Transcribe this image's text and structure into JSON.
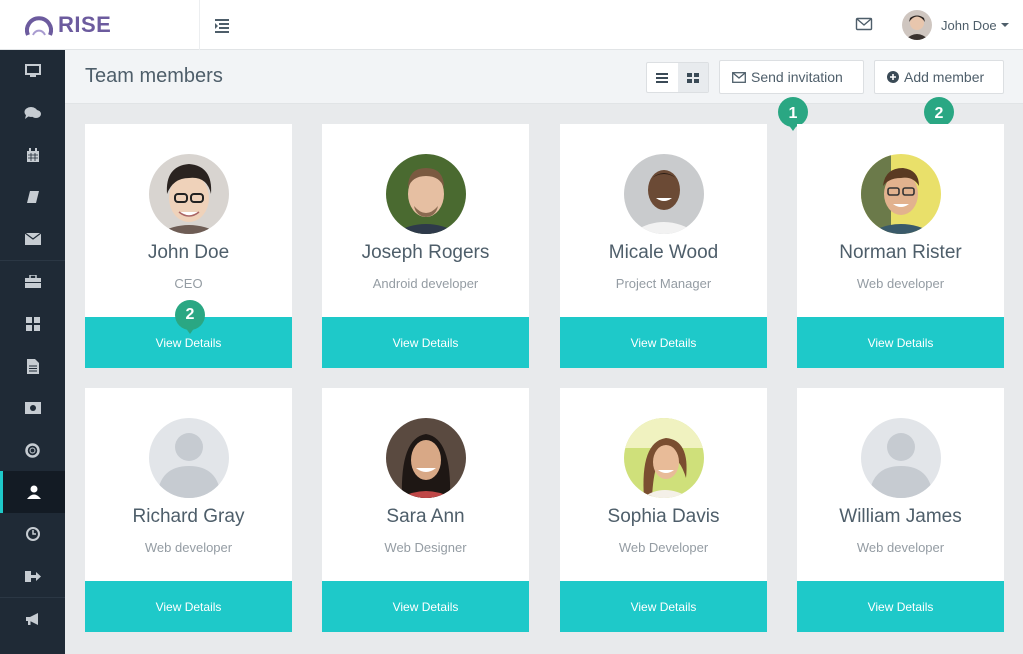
{
  "brand": {
    "name": "RISE"
  },
  "topbar": {
    "user_name": "John Doe"
  },
  "page": {
    "title": "Team members",
    "send_invitation_label": "Send invitation",
    "add_member_label": "Add member"
  },
  "markers": [
    "1",
    "2",
    "2"
  ],
  "colors": {
    "accent": "#1ec9c9",
    "marker": "#2aa783",
    "sidebar": "#1f2a36",
    "brand": "#6c5b9e"
  },
  "sidebar": {
    "items": [
      {
        "icon": "desktop-icon"
      },
      {
        "icon": "comments-icon"
      },
      {
        "icon": "calendar-icon"
      },
      {
        "icon": "book-icon"
      },
      {
        "icon": "envelope-icon"
      },
      {
        "icon": "briefcase-icon"
      },
      {
        "icon": "grid-icon"
      },
      {
        "icon": "file-icon"
      },
      {
        "icon": "money-icon"
      },
      {
        "icon": "life-ring-icon"
      },
      {
        "icon": "user-icon",
        "active": true
      },
      {
        "icon": "clock-icon"
      },
      {
        "icon": "sign-out-icon"
      },
      {
        "icon": "bullhorn-icon"
      }
    ]
  },
  "members": [
    {
      "name": "John Doe",
      "role": "CEO",
      "action": "View Details"
    },
    {
      "name": "Joseph Rogers",
      "role": "Android developer",
      "action": "View Details"
    },
    {
      "name": "Micale Wood",
      "role": "Project Manager",
      "action": "View Details"
    },
    {
      "name": "Norman Rister",
      "role": "Web developer",
      "action": "View Details"
    },
    {
      "name": "Richard Gray",
      "role": "Web developer",
      "action": "View Details"
    },
    {
      "name": "Sara Ann",
      "role": "Web Designer",
      "action": "View Details"
    },
    {
      "name": "Sophia Davis",
      "role": "Web Developer",
      "action": "View Details"
    },
    {
      "name": "William James",
      "role": "Web developer",
      "action": "View Details"
    }
  ]
}
